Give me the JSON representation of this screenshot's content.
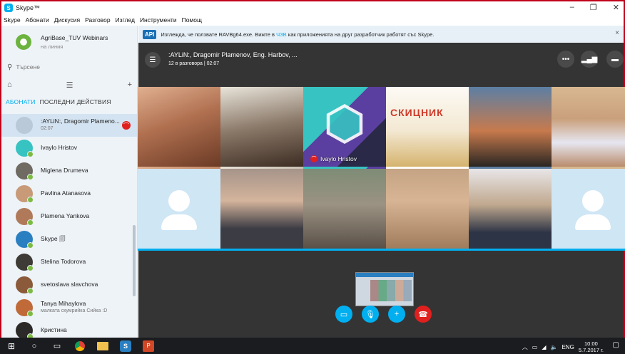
{
  "window": {
    "title": "Skype™",
    "logo": "S"
  },
  "menu": {
    "items": [
      "Skype",
      "Абонати",
      "Дискусия",
      "Разговор",
      "Изглед",
      "Инструменти",
      "Помощ"
    ]
  },
  "profile": {
    "name": "AgriBase_TUV Webinars",
    "status": "на линия"
  },
  "search": {
    "placeholder": "Търсене"
  },
  "tabs": {
    "contacts": "АБОНАТИ",
    "recent": "ПОСЛЕДНИ ДЕЙСТВИЯ"
  },
  "contacts": [
    {
      "name": ":AYLiN:, Dragomir Plameno...",
      "sub": "02:07",
      "color": "#b9c9d8",
      "in_call": true
    },
    {
      "name": "Ivaylo Hristov",
      "sub": "",
      "color": "#37c3c1",
      "in_call": false
    },
    {
      "name": "Miglena Drumeva",
      "sub": "",
      "color": "#6f6a62",
      "in_call": false
    },
    {
      "name": "Pavlina Atanasova",
      "sub": "",
      "color": "#c89a78",
      "in_call": false
    },
    {
      "name": "Plamena Yankova",
      "sub": "",
      "color": "#b07a5a",
      "in_call": false
    },
    {
      "name": "Skype 🗐",
      "sub": "",
      "color": "#2a7fc1",
      "in_call": false
    },
    {
      "name": "Stelina Todorova",
      "sub": "",
      "color": "#3e3a36",
      "in_call": false
    },
    {
      "name": "svetoslava slavchova",
      "sub": "",
      "color": "#8a5a3a",
      "in_call": false
    },
    {
      "name": "Tanya Mihaylova",
      "sub": "малката скумрийка Сийка :D",
      "color": "#c06a3a",
      "in_call": false
    },
    {
      "name": "Кристина",
      "sub": "",
      "color": "#2c2a28",
      "in_call": false
    }
  ],
  "notification": {
    "badge": "API",
    "text_before": "Изглежда, че ползвате RAVBg64.exe. Вижте в",
    "link": "ЧЗВ",
    "text_after": "как приложенията на друг разработчик работят със Skype.",
    "close": "×"
  },
  "call": {
    "title": ":AYLiN:, Dragomir Plamenov, Eng. Harbov, ...",
    "subtitle": "12 в разговора | 02:07",
    "tile_label": "Ivaylo Hristov",
    "skcnik": "СКИЦНИК"
  },
  "taskbar": {
    "lang": "ENG",
    "time": "10:00",
    "date": "5.7.2017 г."
  },
  "colors": {
    "accent": "#00aff0",
    "end_call": "#e0201e",
    "online": "#7cbb42"
  }
}
